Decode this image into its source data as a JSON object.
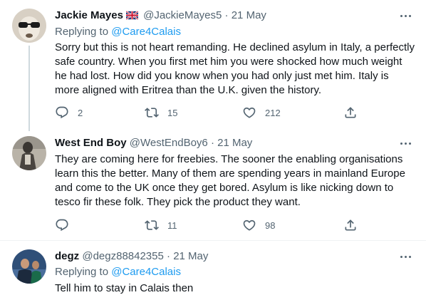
{
  "tweets": [
    {
      "name": "Jackie Mayes",
      "handle": "@JackieMayes5",
      "dot": "·",
      "date": "21 May",
      "replying_label": "Replying to",
      "replying_handle": "@Care4Calais",
      "text": "Sorry but this is not heart remanding. He declined asylum in Italy, a perfectly safe country. When you first met him you were shocked how much weight he had lost. How did you know when you had only just met him. Italy is more aligned with Eritrea than the U.K. given the history.",
      "replies": "2",
      "retweets": "15",
      "likes": "212"
    },
    {
      "name": "West End Boy",
      "handle": "@WestEndBoy6",
      "dot": "·",
      "date": "21 May",
      "text": "They are coming here for freebies. The sooner the enabling organisations learn this the better. Many of them are spending years in mainland Europe and come to the UK once they get bored. Asylum is like nicking down to tesco fir these folk. They pick the product they want.",
      "replies": "",
      "retweets": "11",
      "likes": "98"
    },
    {
      "name": "degz",
      "handle": "@degz88842355",
      "dot": "·",
      "date": "21 May",
      "replying_label": "Replying to",
      "replying_handle": "@Care4Calais",
      "text": "Tell him to stay in Calais then"
    }
  ]
}
